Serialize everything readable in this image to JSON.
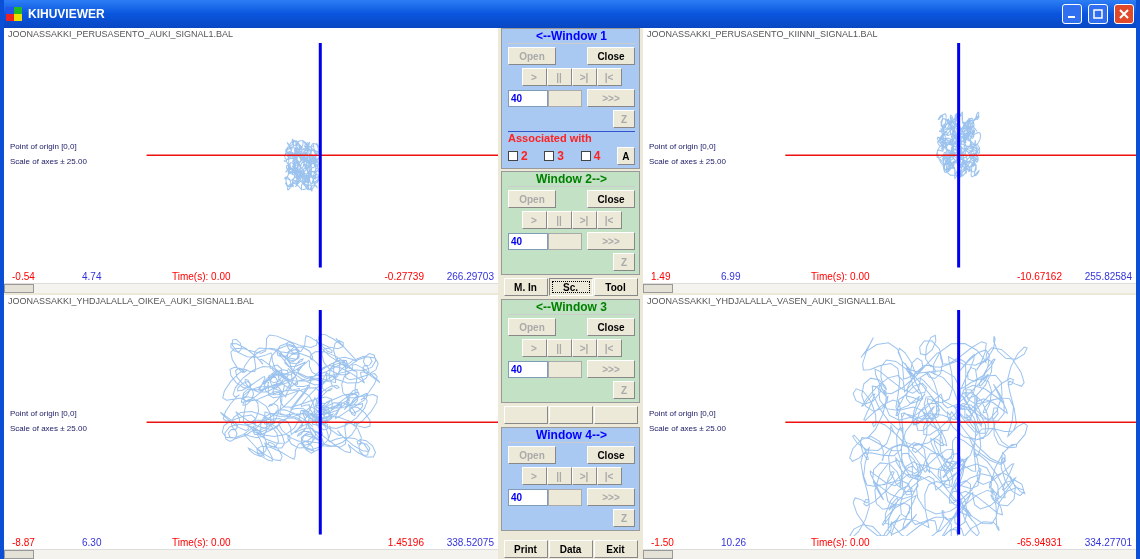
{
  "title": "KIHUVIEWER",
  "plots": [
    {
      "filename": "JOONASSAKKI_PERUSASENTO_AUKI_SIGNAL1.BAL",
      "origin_label": "Point of origin [0,0]",
      "scale_label": "Scale of axes ± 25.00",
      "stats": [
        {
          "text": "-0.54",
          "kind": "red"
        },
        {
          "text": "4.74",
          "kind": "blue"
        },
        {
          "text": "Time(s): 0.00",
          "kind": "red"
        },
        {
          "text": "-0.27739",
          "kind": "red"
        },
        {
          "text": "266.29703",
          "kind": "blue"
        }
      ]
    },
    {
      "filename": "JOONASSAKKI_PERUSASENTO_KIINNI_SIGNAL1.BAL",
      "origin_label": "Point of origin [0,0]",
      "scale_label": "Scale of axes ± 25.00",
      "stats": [
        {
          "text": "1.49",
          "kind": "red"
        },
        {
          "text": "6.99",
          "kind": "blue"
        },
        {
          "text": "Time(s): 0.00",
          "kind": "red"
        },
        {
          "text": "-10.67162",
          "kind": "red"
        },
        {
          "text": "255.82584",
          "kind": "blue"
        }
      ]
    },
    {
      "filename": "JOONASSAKKI_YHDJALALLA_OIKEA_AUKI_SIGNAL1.BAL",
      "origin_label": "Point of origin [0,0]",
      "scale_label": "Scale of axes ± 25.00",
      "stats": [
        {
          "text": "-8.87",
          "kind": "red"
        },
        {
          "text": "6.30",
          "kind": "blue"
        },
        {
          "text": "Time(s): 0.00",
          "kind": "red"
        },
        {
          "text": "1.45196",
          "kind": "red"
        },
        {
          "text": "338.52075",
          "kind": "blue"
        }
      ]
    },
    {
      "filename": "JOONASSAKKI_YHDJALALLA_VASEN_AUKI_SIGNAL1.BAL",
      "origin_label": "Point of origin [0,0]",
      "scale_label": "Scale of axes ± 25.00",
      "stats": [
        {
          "text": "-1.50",
          "kind": "red"
        },
        {
          "text": "10.26",
          "kind": "blue"
        },
        {
          "text": "Time(s): 0.00",
          "kind": "red"
        },
        {
          "text": "-65.94931",
          "kind": "red"
        },
        {
          "text": "334.27701",
          "kind": "blue"
        }
      ]
    }
  ],
  "controls": [
    {
      "title": "<--Window 1",
      "kind": "blue",
      "open": {
        "label": "Open",
        "disabled": true
      },
      "close": {
        "label": "Close",
        "disabled": false
      },
      "playback": [
        {
          "label": ">",
          "disabled": true
        },
        {
          "label": "||",
          "disabled": true
        },
        {
          "label": ">|",
          "disabled": true
        },
        {
          "label": "|<",
          "disabled": true
        }
      ],
      "speed": "40",
      "fast": {
        "label": ">>>",
        "disabled": true
      },
      "zoom": {
        "label": "Z",
        "disabled": true
      },
      "associated": {
        "label": "Associated with",
        "options": [
          {
            "label": "2",
            "checked": false
          },
          {
            "label": "3",
            "checked": false
          },
          {
            "label": "4",
            "checked": false
          }
        ],
        "button": "A"
      }
    },
    {
      "title": "Window 2-->",
      "kind": "green",
      "open": {
        "label": "Open",
        "disabled": true
      },
      "close": {
        "label": "Close",
        "disabled": false
      },
      "playback": [
        {
          "label": ">",
          "disabled": true
        },
        {
          "label": "||",
          "disabled": true
        },
        {
          "label": ">|",
          "disabled": true
        },
        {
          "label": "|<",
          "disabled": true
        }
      ],
      "speed": "40",
      "fast": {
        "label": ">>>",
        "disabled": true
      },
      "zoom": {
        "label": "Z",
        "disabled": true
      }
    },
    {
      "title": "<--Window 3",
      "kind": "green",
      "open": {
        "label": "Open",
        "disabled": true
      },
      "close": {
        "label": "Close",
        "disabled": false
      },
      "playback": [
        {
          "label": ">",
          "disabled": true
        },
        {
          "label": "||",
          "disabled": true
        },
        {
          "label": ">|",
          "disabled": true
        },
        {
          "label": "|<",
          "disabled": true
        }
      ],
      "speed": "40",
      "fast": {
        "label": ">>>",
        "disabled": true
      },
      "zoom": {
        "label": "Z",
        "disabled": true
      }
    },
    {
      "title": "Window 4-->",
      "kind": "blue",
      "open": {
        "label": "Open",
        "disabled": true
      },
      "close": {
        "label": "Close",
        "disabled": false
      },
      "playback": [
        {
          "label": ">",
          "disabled": true
        },
        {
          "label": "||",
          "disabled": true
        },
        {
          "label": ">|",
          "disabled": true
        },
        {
          "label": "|<",
          "disabled": true
        }
      ],
      "speed": "40",
      "fast": {
        "label": ">>>",
        "disabled": true
      },
      "zoom": {
        "label": "Z",
        "disabled": true
      }
    }
  ],
  "view_buttons": [
    {
      "label": "M. In",
      "selected": false
    },
    {
      "label": "Sc.",
      "selected": true
    },
    {
      "label": "Tool",
      "selected": false
    }
  ],
  "bottom_buttons": [
    {
      "label": "Print"
    },
    {
      "label": "Data"
    },
    {
      "label": "Exit"
    }
  ]
}
